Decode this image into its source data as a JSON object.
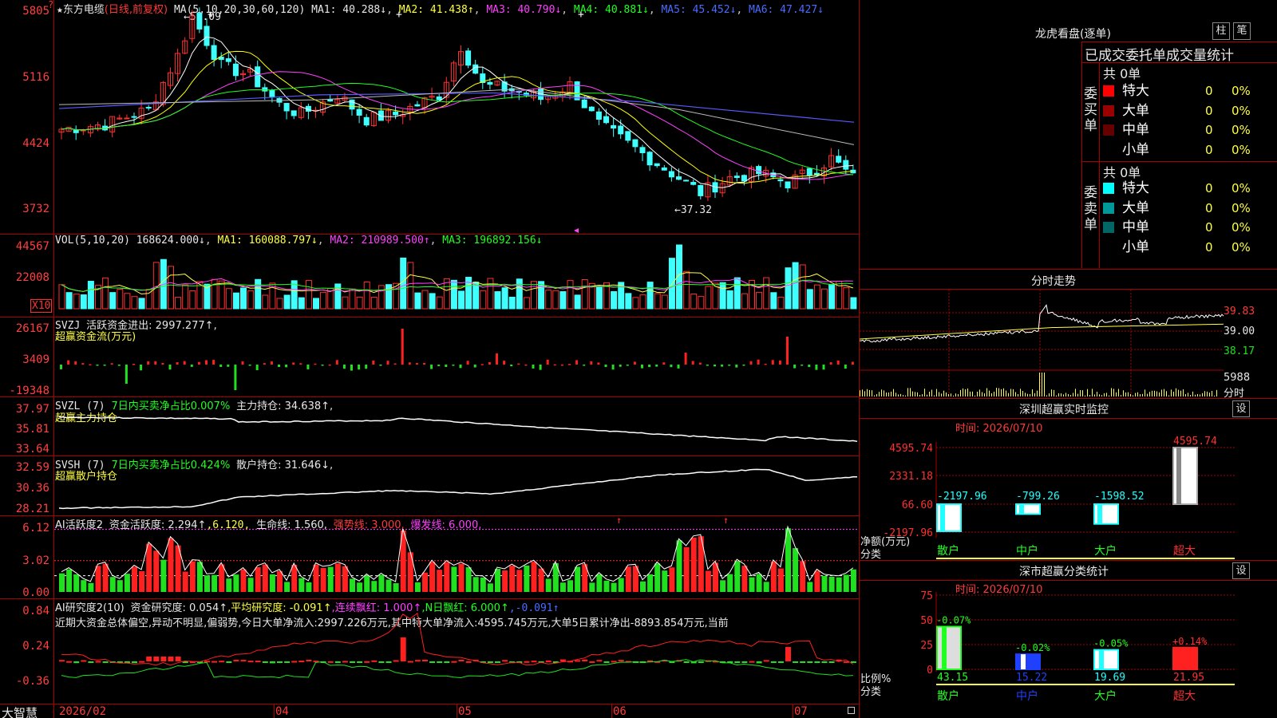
{
  "stock": {
    "name": "东方电缆",
    "period": "(日线,前复权)",
    "star": "★"
  },
  "price_panel": {
    "ma_label": "MA(5,10,20,30,60,120)",
    "ma1": "MA1: 40.288↓",
    "ma2": "MA2: 41.438↑",
    "ma3": "MA3: 40.790↓",
    "ma4": "MA4: 40.881↓",
    "ma5": "MA5: 45.452↓",
    "ma6": "MA6: 47.427↓",
    "y_labels": [
      "5805",
      "5116",
      "4424",
      "3732"
    ],
    "high_mark": "58.09",
    "low_mark": "37.32",
    "colors": {
      "ma1": "#ffffff",
      "ma2": "#ffff00",
      "ma3": "#ff40ff",
      "ma4": "#20ff20",
      "ma5": "#5a5aff",
      "ma6": "#bbbbbb",
      "up": "#ff3030",
      "down": "#40ffff"
    }
  },
  "vol_panel": {
    "label": "VOL(5,10,20)",
    "value": "168624.000↓",
    "ma1": "MA1: 160088.797↓",
    "ma2": "MA2: 210989.500↑",
    "ma3": "MA3: 196892.156↓",
    "y_labels": [
      "44567",
      "22008"
    ],
    "unit": "X10"
  },
  "svzj_panel": {
    "label": "SVZJ",
    "desc": "活跃资金进出: 2997.277↑,",
    "sub": "超赢资金流(万元)",
    "y_labels": [
      "26167",
      "3409",
      "-19348"
    ]
  },
  "svzl_panel": {
    "label": "SVZL (7)",
    "desc": "7日内买卖净占比0.007%",
    "hold": "主力持仓: 34.638↑,",
    "sub": "超赢主力持仓",
    "y_labels": [
      "37.97",
      "35.81",
      "33.64"
    ]
  },
  "svsh_panel": {
    "label": "SVSH (7)",
    "desc": "7日内买卖净占比0.424%",
    "hold": "散户持仓: 31.646↓,",
    "sub": "超赢散户持仓",
    "y_labels": [
      "32.59",
      "30.36",
      "28.21"
    ]
  },
  "ai1_panel": {
    "label": "AI活跃度2",
    "v1": "资金活跃度: 2.294↑",
    "v2": ",6.120,",
    "v3": "生命线: 1.560,",
    "v4": "强势线: 3.000,",
    "v5": "爆发线: 6.000,",
    "y_labels": [
      "6.12",
      "3.02",
      "0.00"
    ]
  },
  "ai2_panel": {
    "label": "AI研究度2(10)",
    "v1": "资金研究度: 0.054↑",
    "v2": ",平均研究度: -0.091↑",
    "v3": ",连续飘红: 1.000↑",
    "v4": ",N日飘红: 6.000↑",
    "v5": ",-0.091↑",
    "summary": "近期大资金总体偏空,异动不明显,偏弱势,今日大单净流入:2997.226万元,其中特大单净流入:4595.745万元,大单5日累计净出-8893.854万元,当前",
    "y_labels": [
      "0.84",
      "0.24",
      "-0.36"
    ]
  },
  "x_axis": {
    "labels": [
      "2026/02",
      "04",
      "05",
      "06",
      "07"
    ],
    "brand": "大智慧"
  },
  "dragon": {
    "title": "龙虎看盘(逐单)",
    "btn1": "柱",
    "btn2": "笔",
    "subtitle": "已成交委托单成交量统计",
    "buy": {
      "side": "委买单",
      "total": "共 0单",
      "rows": [
        {
          "name": "特大",
          "val": "0",
          "pct": "0%",
          "color": "#ff0000"
        },
        {
          "name": "大单",
          "val": "0",
          "pct": "0%",
          "color": "#990000"
        },
        {
          "name": "中单",
          "val": "0",
          "pct": "0%",
          "color": "#660000"
        },
        {
          "name": "小单",
          "val": "0",
          "pct": "0%",
          "color": ""
        }
      ]
    },
    "sell": {
      "side": "委卖单",
      "total": "共 0单",
      "rows": [
        {
          "name": "特大",
          "val": "0",
          "pct": "0%",
          "color": "#00ffff"
        },
        {
          "name": "大单",
          "val": "0",
          "pct": "0%",
          "color": "#009999"
        },
        {
          "name": "中单",
          "val": "0",
          "pct": "0%",
          "color": "#006666"
        },
        {
          "name": "小单",
          "val": "0",
          "pct": "0%",
          "color": ""
        }
      ]
    }
  },
  "intraday": {
    "title": "分时走势",
    "y_labels": [
      "39.83",
      "39.00",
      "38.17"
    ],
    "vol_label": "5988",
    "vol_unit": "分时"
  },
  "sz_monitor": {
    "title": "深圳超赢实时监控",
    "btn": "设",
    "time": "时间: 2026/07/10",
    "y_labels": [
      "4595.74",
      "2331.18",
      "66.60",
      "-2197.96"
    ],
    "ylabel1": "净额(万元)",
    "ylabel2": "分类",
    "cats": [
      "散户",
      "中户",
      "大户",
      "超大"
    ],
    "values": [
      "-2197.96",
      "-799.26",
      "-1598.52",
      "4595.74"
    ]
  },
  "sz_stats": {
    "title": "深市超赢分类统计",
    "btn": "设",
    "time": "时间: 2026/07/10",
    "y_labels": [
      "75",
      "50",
      "25",
      "0"
    ],
    "ylabel1": "比例%",
    "ylabel2": "分类",
    "cats": [
      "散户",
      "中户",
      "大户",
      "超大"
    ],
    "pct": [
      "43.15",
      "15.22",
      "19.69",
      "21.95"
    ],
    "delta": [
      "-0.07%",
      "-0.02%",
      "-0.05%",
      "+0.14%"
    ]
  }
}
